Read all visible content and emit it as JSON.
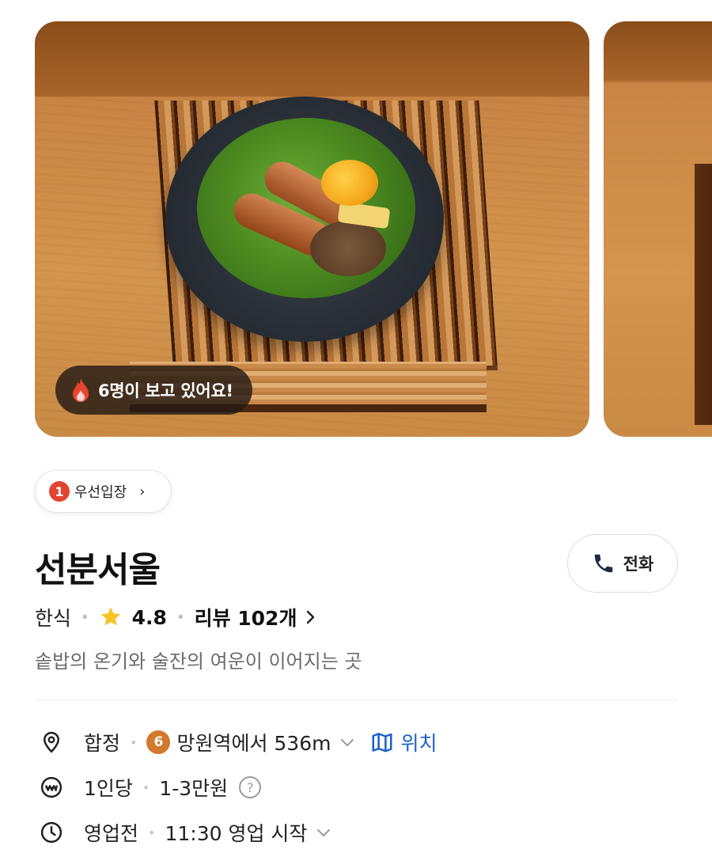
{
  "carousel": {
    "viewer_badge": "6명이 보고 있어요!"
  },
  "priority": {
    "number": "1",
    "label": "우선입장",
    "chevron": "›"
  },
  "store": {
    "name": "선분서울",
    "call_label": "전화",
    "category": "한식",
    "rating": "4.8",
    "review_label": "리뷰 102개",
    "tagline": "솥밥의 온기와 술잔의 여운이 이어지는 곳"
  },
  "info": {
    "location": {
      "area": "합정",
      "line_number": "6",
      "distance": "망원역에서 536m",
      "map_label": "위치"
    },
    "price": {
      "unit": "1인당",
      "range": "1-3만원",
      "help": "?"
    },
    "hours": {
      "status": "영업전",
      "open_text": "11:30 영업 시작"
    }
  },
  "colors": {
    "accent_blue": "#1a5fc8",
    "priority_red": "#e0452f",
    "line6_orange": "#d27a2c",
    "star_yellow": "#f7c325"
  },
  "icons": [
    "flame-icon",
    "phone-icon",
    "star-icon",
    "chevron-right-icon",
    "location-pin-icon",
    "chevron-down-icon",
    "map-icon",
    "wallet-icon",
    "help-icon",
    "clock-icon"
  ]
}
